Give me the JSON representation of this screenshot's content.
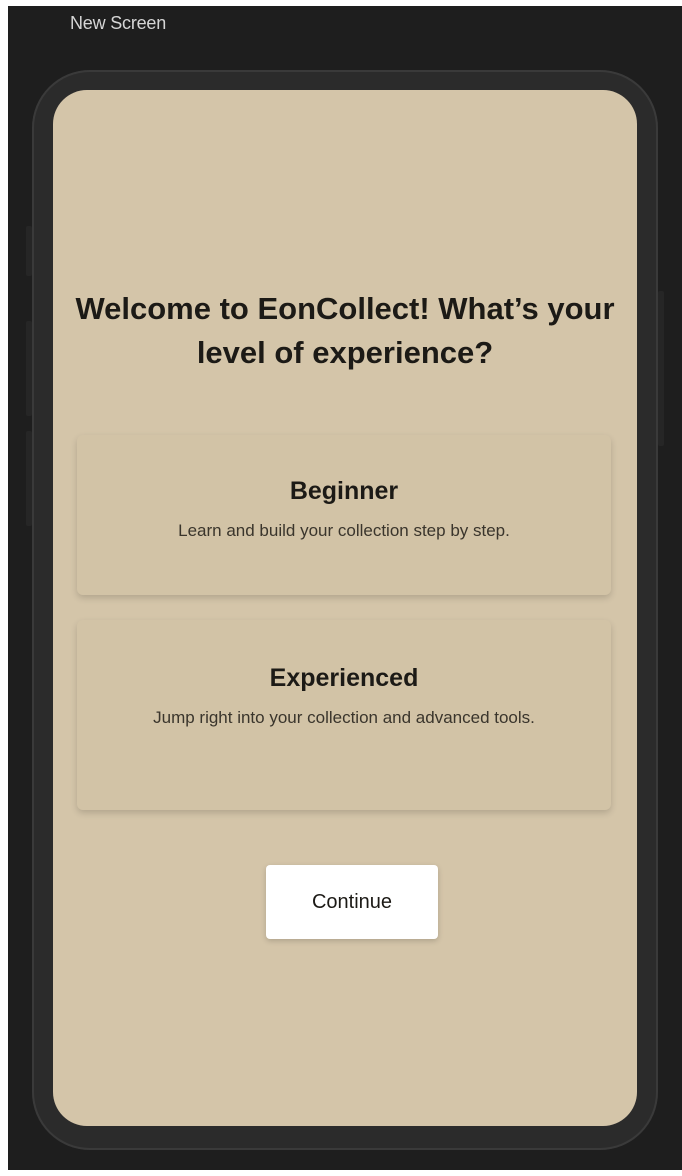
{
  "canvas": {
    "screen_label": "New Screen"
  },
  "onboarding": {
    "heading": "Welcome to EonCollect! What’s your level of experience?",
    "options": [
      {
        "title": "Beginner",
        "description": "Learn and build your collection step by step."
      },
      {
        "title": "Experienced",
        "description": "Jump right into your collection and advanced tools."
      }
    ],
    "continue_label": "Continue"
  },
  "colors": {
    "screen_background": "#d4c5a9",
    "card_background": "#d2c3a6",
    "device_frame": "#2b2b2b",
    "canvas_background": "#1e1e1e",
    "button_background": "#ffffff"
  }
}
